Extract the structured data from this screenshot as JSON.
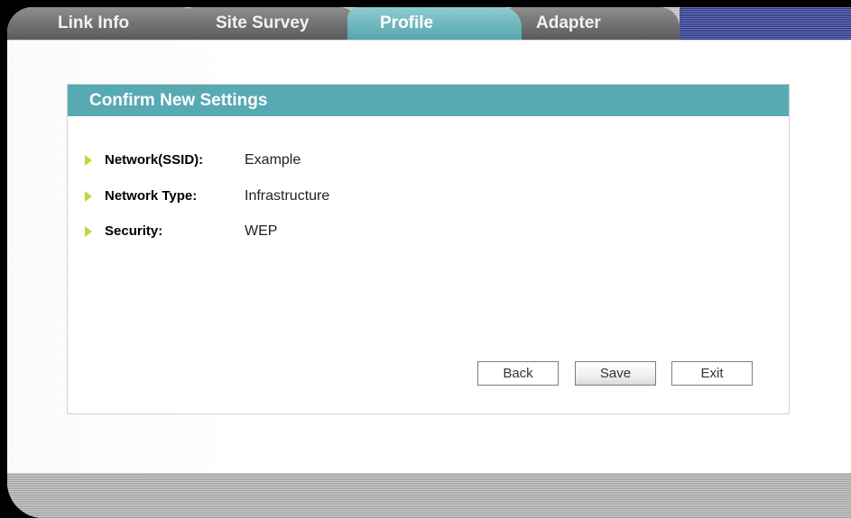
{
  "tabs": [
    {
      "label": "Link Info",
      "active": false
    },
    {
      "label": "Site Survey",
      "active": false
    },
    {
      "label": "Profile",
      "active": true
    },
    {
      "label": "Adapter",
      "active": false
    }
  ],
  "panel": {
    "title": "Confirm New Settings",
    "fields": [
      {
        "label": "Network(SSID):",
        "value": "Example"
      },
      {
        "label": "Network Type:",
        "value": "Infrastructure"
      },
      {
        "label": "Security:",
        "value": "WEP"
      }
    ]
  },
  "buttons": {
    "back": "Back",
    "save": "Save",
    "exit": "Exit"
  },
  "colors": {
    "accent": "#57aab2",
    "bullet": "#c8d436",
    "tab_inactive": "#6e6e6e",
    "tab_active": "#6fb8be",
    "title_stripe": "#2a3383"
  },
  "icons": {
    "bullet": "chevron-right-icon"
  }
}
